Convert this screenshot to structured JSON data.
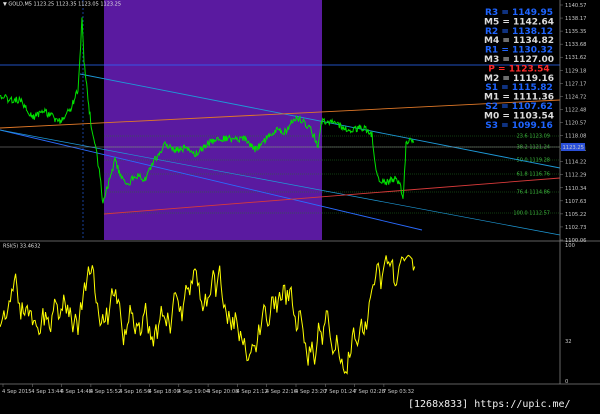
{
  "header": {
    "symbol_line": "▼ GOLD,M5  1123.25  1123.35  1123.05  1123.25"
  },
  "indicator": {
    "label": "RSI(5) 33.4632",
    "levels": [
      "100",
      "32",
      "0"
    ]
  },
  "price_axis": {
    "ticks": [
      "1140.57",
      "1138.17",
      "1135.35",
      "1133.68",
      "1131.62",
      "1129.18",
      "1127.17",
      "1124.72",
      "1122.48",
      "1120.57",
      "1118.08",
      "1116.11",
      "1114.22",
      "1112.29",
      "1110.34",
      "1107.63",
      "1105.22",
      "1102.73",
      "1100.06"
    ],
    "current_price": "1123.25"
  },
  "pivots": [
    {
      "label": "R3 = 1149.95",
      "color": "#1e64ff"
    },
    {
      "label": "M5 = 1142.64",
      "color": "#dcdcdc"
    },
    {
      "label": "R2 = 1138.12",
      "color": "#1e64ff"
    },
    {
      "label": "M4 = 1134.82",
      "color": "#dcdcdc"
    },
    {
      "label": "R1 = 1130.32",
      "color": "#1e64ff"
    },
    {
      "label": "M3 = 1127.00",
      "color": "#dcdcdc"
    },
    {
      "label": "P  = 1123.54",
      "color": "#ff2a2a"
    },
    {
      "label": "M2 = 1119.16",
      "color": "#dcdcdc"
    },
    {
      "label": "S1 = 1115.82",
      "color": "#1e64ff"
    },
    {
      "label": "M1 = 1111.36",
      "color": "#dcdcdc"
    },
    {
      "label": "S2 = 1107.62",
      "color": "#1e64ff"
    },
    {
      "label": "M0 = 1103.54",
      "color": "#dcdcdc"
    },
    {
      "label": "S3 = 1099.16",
      "color": "#1e64ff"
    }
  ],
  "fib_labels": [
    "23.6 1123.09",
    "38.2 1121.24",
    "50.0 1119.28",
    "61.8 1116.76",
    "76.4 1114.86",
    "100.0 1112.57"
  ],
  "time_axis": [
    "4 Sep 2015",
    "4 Sep 13:44",
    "4 Sep 14:48",
    "4 Sep 15:52",
    "4 Sep 16:56",
    "4 Sep 18:00",
    "4 Sep 19:04",
    "4 Sep 20:08",
    "4 Sep 21:12",
    "4 Sep 22:16",
    "4 Sep 23:20",
    "7 Sep 01:24",
    "7 Sep 02:28",
    "7 Sep 03:32"
  ],
  "watermark": "[1268x833] https://upic.me/",
  "colors": {
    "price_line": "#00e000",
    "rsi_line": "#ffff00",
    "highlight_box": "#5a1aa0",
    "blue_trend": "#2a6bff",
    "cyan_trend": "#1e9ad8",
    "orange_trend": "#e07828",
    "red_trend": "#d83a3a"
  }
}
